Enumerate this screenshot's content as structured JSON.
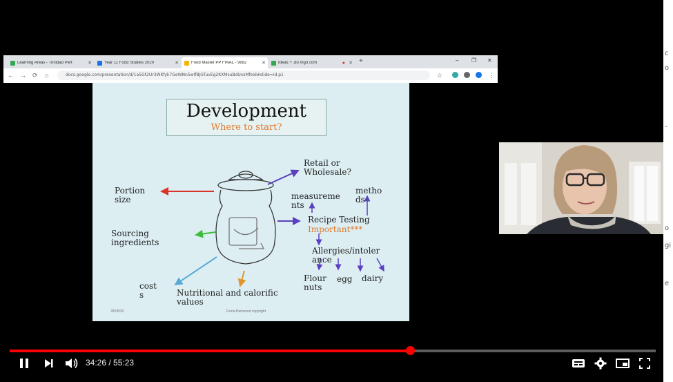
{
  "browser": {
    "tabs": [
      {
        "label": "Learning Areas - Trinidad Perth",
        "favicon_color": "#34a853"
      },
      {
        "label": "Year 11 Food Studies 2020",
        "favicon_color": "#1a73e8"
      },
      {
        "label": "Food Master PP FINAL - 9b82a...",
        "favicon_color": "#f4b400"
      },
      {
        "label": "Ideas + .do mgo com",
        "favicon_color": "#34a853"
      }
    ],
    "url": "docs.google.com/presentation/d/1a5Gt2Ur3WKfyk7GeWNn5wIfBJGTuvEg2KXMsuBdUxsMfeid#slide=id.p1"
  },
  "slide": {
    "title": "Development",
    "subtitle": "Where to start?",
    "labels": {
      "retail": "Retail or\nWholesale?",
      "portion": "Portion\nsize",
      "measurements": "measureme\nnts",
      "methods": "metho\nds",
      "recipe_testing": "Recipe Testing",
      "important": "Important***",
      "sourcing": "Sourcing\ningredients",
      "allergies": "Allergies/intoler\nance",
      "flour": "Flour\nnuts",
      "egg": "egg",
      "dairy": "dairy",
      "costs": "cost\ns",
      "nutritional": "Nutritional and calorific\nvalues"
    },
    "footer_date": "28/05/20",
    "footer_copyright": "Fiona Hartwood copyright"
  },
  "player": {
    "current_time": "34:26",
    "separator": " / ",
    "duration": "55:23",
    "progress_fraction": 0.62,
    "accent_color": "#ff0000"
  },
  "side_fragments": [
    "c",
    "o",
    "-",
    "o",
    "gi",
    "e"
  ]
}
